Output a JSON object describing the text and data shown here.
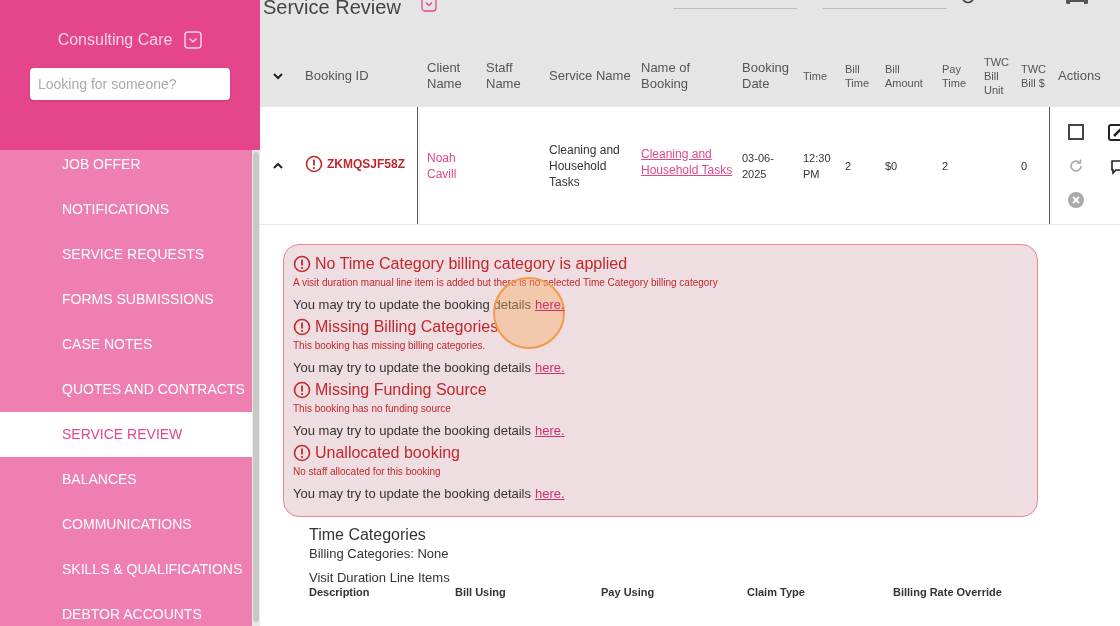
{
  "sidebar": {
    "brand": "Consulting Care",
    "search": {
      "placeholder": "Looking for someone?"
    },
    "items": [
      {
        "label": "JOB OFFER",
        "selected": false
      },
      {
        "label": "NOTIFICATIONS",
        "selected": false
      },
      {
        "label": "SERVICE REQUESTS",
        "selected": false
      },
      {
        "label": "FORMS SUBMISSIONS",
        "selected": false
      },
      {
        "label": "CASE NOTES",
        "selected": false
      },
      {
        "label": "QUOTES AND CONTRACTS",
        "selected": false
      },
      {
        "label": "SERVICE REVIEW",
        "selected": true
      },
      {
        "label": "BALANCES",
        "selected": false
      },
      {
        "label": "COMMUNICATIONS",
        "selected": false
      },
      {
        "label": "SKILLS & QUALIFICATIONS",
        "selected": false
      },
      {
        "label": "DEBTOR ACCOUNTS",
        "selected": false
      }
    ]
  },
  "page": {
    "title": "Service Review"
  },
  "table": {
    "columns": [
      "Booking ID",
      "Client Name",
      "Staff Name",
      "Service Name",
      "Name of Booking",
      "Booking Date",
      "Time",
      "Bill Time",
      "Bill Amount",
      "Pay Time",
      "TWC Bill Unit",
      "TWC Bill $",
      "Actions"
    ],
    "rows": [
      {
        "expanded": true,
        "has_error": true,
        "booking_id": "ZKMQSJF58Z",
        "client_name": "Noah Cavill",
        "staff_name": "",
        "service_name": "Cleaning and Household Tasks",
        "name_of_booking": "Cleaning and Household Tasks",
        "booking_date": "03-06-2025",
        "time": "12:30 PM",
        "bill_time": "2",
        "bill_amount": "$0",
        "pay_time": "2",
        "twc_bill_unit": "",
        "twc_bill": "0",
        "checked": false
      }
    ]
  },
  "alerts": [
    {
      "title": "No Time Category billing category is applied",
      "description": "A visit duration manual line item is added but there is no selected Time Category billing category",
      "prompt": "You may try to update the booking details",
      "link": "here."
    },
    {
      "title": "Missing Billing Categories",
      "description": "This booking has missing billing categories.",
      "prompt": "You may try to update the booking details",
      "link": "here."
    },
    {
      "title": "Missing Funding Source",
      "description": "This booking has no funding source",
      "prompt": "You may try to update the booking details",
      "link": "here."
    },
    {
      "title": "Unallocated booking",
      "description": "No staff allocated for this booking",
      "prompt": "You may try to update the booking details",
      "link": "here."
    }
  ],
  "details": {
    "title": "Time Categories",
    "billing_categories": "Billing Categories: None",
    "line_items_title": "Visit Duration Line Items",
    "line_item_columns": [
      "Description",
      "Bill Using",
      "Pay Using",
      "Claim Type",
      "Billing Rate Override"
    ]
  }
}
